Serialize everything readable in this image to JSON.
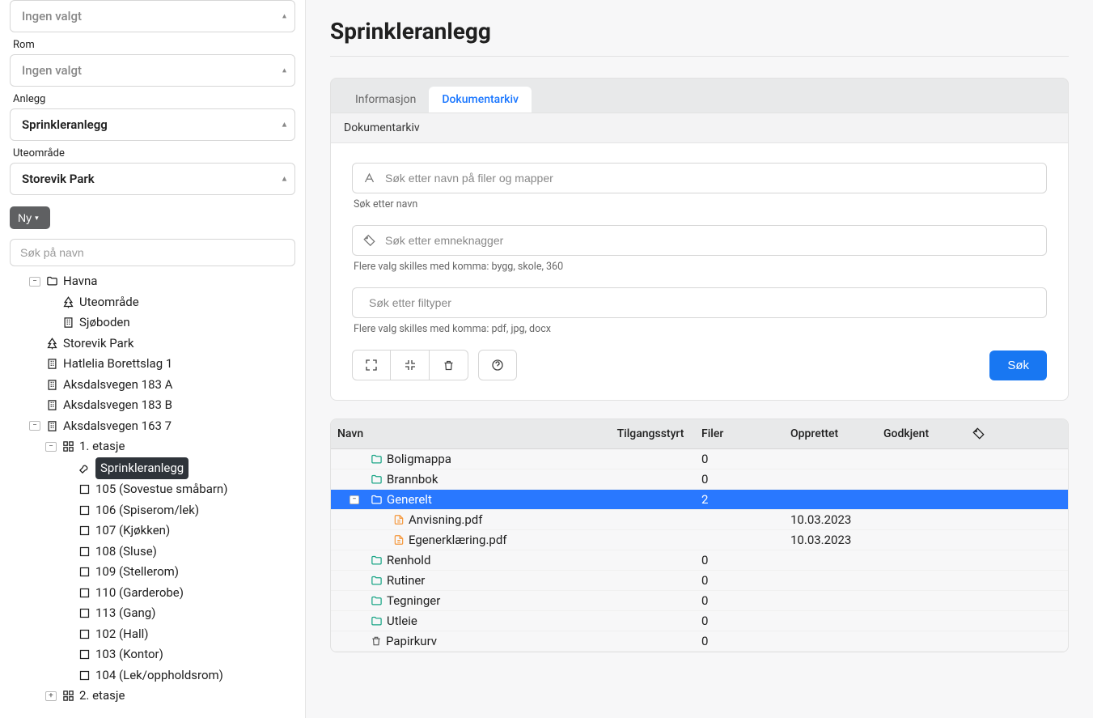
{
  "sidebar": {
    "selects": [
      {
        "label": "",
        "value": "Ingen valgt",
        "placeholder": true
      },
      {
        "label": "Rom",
        "value": "Ingen valgt",
        "placeholder": true
      },
      {
        "label": "Anlegg",
        "value": "Sprinkleranlegg",
        "placeholder": false
      },
      {
        "label": "Uteområde",
        "value": "Storevik Park",
        "placeholder": false
      }
    ],
    "new_btn": "Ny",
    "search_placeholder": "Søk på navn",
    "tree": [
      {
        "indent": 0,
        "toggle": "-",
        "icon": "folder",
        "label": "Havna"
      },
      {
        "indent": 1,
        "toggle": "",
        "icon": "tree",
        "label": "Uteområde"
      },
      {
        "indent": 1,
        "toggle": "",
        "icon": "building",
        "label": "Sjøboden"
      },
      {
        "indent": 0,
        "toggle": "",
        "icon": "tree",
        "label": "Storevik Park"
      },
      {
        "indent": 0,
        "toggle": "",
        "icon": "building",
        "label": "Hatlelia Borettslag 1"
      },
      {
        "indent": 0,
        "toggle": "",
        "icon": "building",
        "label": "Aksdalsvegen 183 A"
      },
      {
        "indent": 0,
        "toggle": "",
        "icon": "building",
        "label": "Aksdalsvegen 183 B"
      },
      {
        "indent": 0,
        "toggle": "-",
        "icon": "building",
        "label": "Aksdalsvegen 163 7"
      },
      {
        "indent": 1,
        "toggle": "-",
        "icon": "grid",
        "label": "1. etasje"
      },
      {
        "indent": 2,
        "toggle": "",
        "icon": "wrench",
        "label": "Sprinkleranlegg",
        "selected": true
      },
      {
        "indent": 2,
        "toggle": "",
        "icon": "square",
        "label": "105 (Sovestue småbarn)"
      },
      {
        "indent": 2,
        "toggle": "",
        "icon": "square",
        "label": "106 (Spiserom/lek)"
      },
      {
        "indent": 2,
        "toggle": "",
        "icon": "square",
        "label": "107 (Kjøkken)"
      },
      {
        "indent": 2,
        "toggle": "",
        "icon": "square",
        "label": "108 (Sluse)"
      },
      {
        "indent": 2,
        "toggle": "",
        "icon": "square",
        "label": "109 (Stellerom)"
      },
      {
        "indent": 2,
        "toggle": "",
        "icon": "square",
        "label": "110 (Garderobe)"
      },
      {
        "indent": 2,
        "toggle": "",
        "icon": "square",
        "label": "113 (Gang)"
      },
      {
        "indent": 2,
        "toggle": "",
        "icon": "square",
        "label": "102 (Hall)"
      },
      {
        "indent": 2,
        "toggle": "",
        "icon": "square",
        "label": "103 (Kontor)"
      },
      {
        "indent": 2,
        "toggle": "",
        "icon": "square",
        "label": "104 (Lek/oppholdsrom)"
      },
      {
        "indent": 1,
        "toggle": "+",
        "icon": "grid",
        "label": "2. etasje"
      }
    ]
  },
  "main": {
    "title": "Sprinkleranlegg",
    "tabs": [
      {
        "label": "Informasjon",
        "active": false
      },
      {
        "label": "Dokumentarkiv",
        "active": true
      }
    ],
    "panel_header": "Dokumentarkiv",
    "search_name_placeholder": "Søk etter navn på filer og mapper",
    "search_name_hint": "Søk etter navn",
    "search_tags_placeholder": "Søk etter emneknagger",
    "search_tags_hint": "Flere valg skilles med komma: bygg, skole, 360",
    "search_types_placeholder": "Søk etter filtyper",
    "search_types_hint": "Flere valg skilles med komma: pdf, jpg, docx",
    "search_btn": "Søk",
    "columns": {
      "name": "Navn",
      "access": "Tilgangsstyrt",
      "files": "Filer",
      "created": "Opprettet",
      "approved": "Godkjent"
    },
    "rows": [
      {
        "indent": 0,
        "type": "folder",
        "name": "Boligmappa",
        "files": "0",
        "created": "",
        "approved": ""
      },
      {
        "indent": 0,
        "type": "folder",
        "name": "Brannbok",
        "files": "0",
        "created": "",
        "approved": ""
      },
      {
        "indent": 0,
        "type": "folder",
        "name": "Generelt",
        "files": "2",
        "created": "",
        "approved": "",
        "selected": true,
        "expanded": true
      },
      {
        "indent": 1,
        "type": "file",
        "name": "Anvisning.pdf",
        "files": "",
        "created": "10.03.2023",
        "approved": ""
      },
      {
        "indent": 1,
        "type": "file",
        "name": "Egenerklæring.pdf",
        "files": "",
        "created": "10.03.2023",
        "approved": ""
      },
      {
        "indent": 0,
        "type": "folder",
        "name": "Renhold",
        "files": "0",
        "created": "",
        "approved": ""
      },
      {
        "indent": 0,
        "type": "folder",
        "name": "Rutiner",
        "files": "0",
        "created": "",
        "approved": ""
      },
      {
        "indent": 0,
        "type": "folder",
        "name": "Tegninger",
        "files": "0",
        "created": "",
        "approved": ""
      },
      {
        "indent": 0,
        "type": "folder",
        "name": "Utleie",
        "files": "0",
        "created": "",
        "approved": ""
      },
      {
        "indent": 0,
        "type": "trash",
        "name": "Papirkurv",
        "files": "0",
        "created": "",
        "approved": ""
      }
    ]
  }
}
